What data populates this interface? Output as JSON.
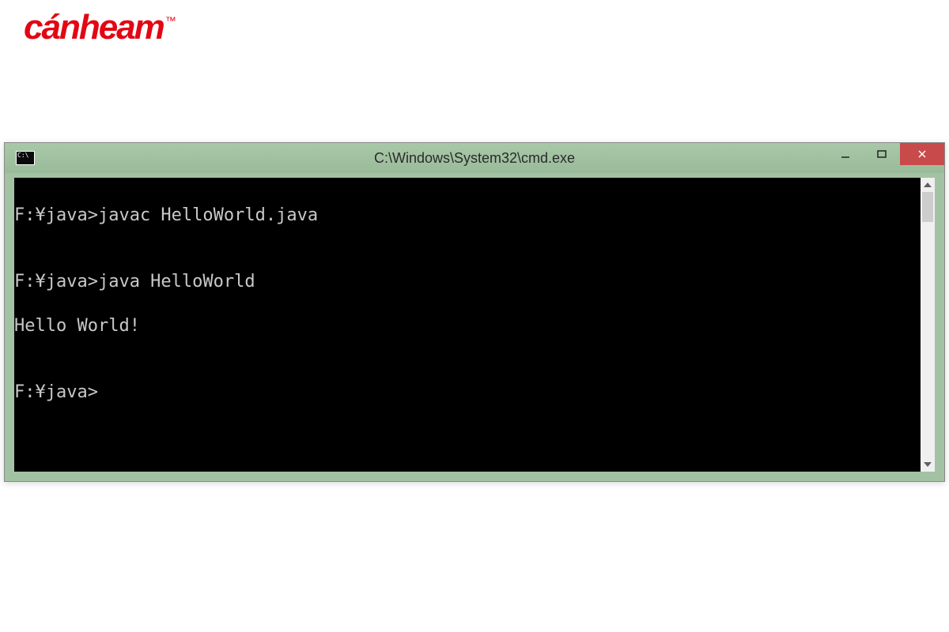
{
  "logo": {
    "text": "cánheam",
    "tm": "™"
  },
  "window": {
    "title": "C:\\Windows\\System32\\cmd.exe"
  },
  "terminal": {
    "lines": [
      "F:¥java>javac HelloWorld.java",
      "",
      "F:¥java>java HelloWorld",
      "Hello World!",
      "",
      "F:¥java>"
    ]
  }
}
